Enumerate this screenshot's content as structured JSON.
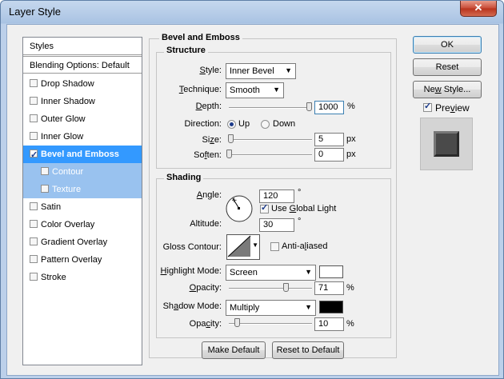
{
  "window": {
    "title": "Layer Style",
    "close_glyph": "✕"
  },
  "styles_list": {
    "header": "Styles",
    "blending": "Blending Options: Default",
    "items": [
      {
        "label": "Drop Shadow",
        "checked": false
      },
      {
        "label": "Inner Shadow",
        "checked": false
      },
      {
        "label": "Outer Glow",
        "checked": false
      },
      {
        "label": "Inner Glow",
        "checked": false
      },
      {
        "label": "Bevel and Emboss",
        "checked": true,
        "selected": true
      },
      {
        "label": "Contour",
        "checked": false,
        "sub": true
      },
      {
        "label": "Texture",
        "checked": false,
        "sub": true
      },
      {
        "label": "Satin",
        "checked": false
      },
      {
        "label": "Color Overlay",
        "checked": false
      },
      {
        "label": "Gradient Overlay",
        "checked": false
      },
      {
        "label": "Pattern Overlay",
        "checked": false
      },
      {
        "label": "Stroke",
        "checked": false
      }
    ]
  },
  "bevel": {
    "group_title": "Bevel and Emboss",
    "structure_title": "Structure",
    "style_label": "Style:",
    "style_value": "Inner Bevel",
    "technique_label": "Technique:",
    "technique_value": "Smooth",
    "depth_label": "Depth:",
    "depth_value": "1000",
    "depth_unit": "%",
    "depth_level": 1.0,
    "direction_label": "Direction:",
    "direction_up": "Up",
    "direction_down": "Down",
    "direction_selected": "Up",
    "size_label": "Size:",
    "size_value": "5",
    "size_unit": "px",
    "size_level": 0.02,
    "soften_label": "Soften:",
    "soften_value": "0",
    "soften_unit": "px",
    "soften_level": 0.0
  },
  "shading": {
    "title": "Shading",
    "angle_label": "Angle:",
    "angle_value": "120",
    "angle_unit": "°",
    "global_light_label": "Use Global Light",
    "global_light_checked": true,
    "altitude_label": "Altitude:",
    "altitude_value": "30",
    "altitude_unit": "°",
    "gloss_label": "Gloss Contour:",
    "anti_aliased_label": "Anti-aliased",
    "anti_aliased_checked": false,
    "highlight_mode_label": "Highlight Mode:",
    "highlight_mode_value": "Screen",
    "highlight_color": "#ffffff",
    "highlight_opacity_label": "Opacity:",
    "highlight_opacity_value": "71",
    "highlight_opacity_unit": "%",
    "highlight_opacity_level": 0.71,
    "shadow_mode_label": "Shadow Mode:",
    "shadow_mode_value": "Multiply",
    "shadow_color": "#000000",
    "shadow_opacity_label": "Opacity:",
    "shadow_opacity_value": "10",
    "shadow_opacity_unit": "%",
    "shadow_opacity_level": 0.1
  },
  "footer": {
    "make_default": "Make Default",
    "reset_default": "Reset to Default"
  },
  "actions": {
    "ok": "OK",
    "reset": "Reset",
    "new_style": "New Style...",
    "preview_label": "Preview",
    "preview_checked": true
  }
}
